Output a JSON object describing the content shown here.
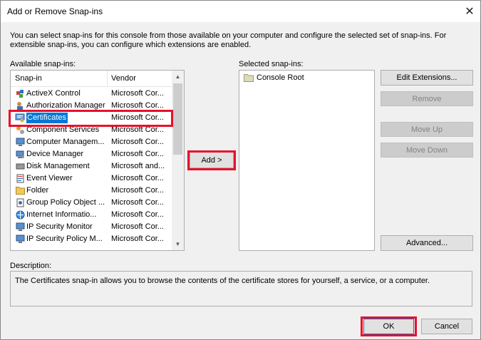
{
  "window": {
    "title": "Add or Remove Snap-ins",
    "close_glyph": "✕"
  },
  "intro_text": "You can select snap-ins for this console from those available on your computer and configure the selected set of snap-ins. For extensible snap-ins, you can configure which extensions are enabled.",
  "available": {
    "label": "Available snap-ins:",
    "columns": {
      "snapin": "Snap-in",
      "vendor": "Vendor"
    },
    "rows": [
      {
        "name": "ActiveX Control",
        "vendor": "Microsoft Cor...",
        "icon": "activex-icon"
      },
      {
        "name": "Authorization Manager",
        "vendor": "Microsoft Cor...",
        "icon": "authorization-manager-icon"
      },
      {
        "name": "Certificates",
        "vendor": "Microsoft Cor...",
        "icon": "certificates-icon",
        "selected": true
      },
      {
        "name": "Component Services",
        "vendor": "Microsoft Cor...",
        "icon": "component-services-icon"
      },
      {
        "name": "Computer Managem...",
        "vendor": "Microsoft Cor...",
        "icon": "computer-management-icon"
      },
      {
        "name": "Device Manager",
        "vendor": "Microsoft Cor...",
        "icon": "device-manager-icon"
      },
      {
        "name": "Disk Management",
        "vendor": "Microsoft and...",
        "icon": "disk-management-icon"
      },
      {
        "name": "Event Viewer",
        "vendor": "Microsoft Cor...",
        "icon": "event-viewer-icon"
      },
      {
        "name": "Folder",
        "vendor": "Microsoft Cor...",
        "icon": "folder-icon"
      },
      {
        "name": "Group Policy Object ...",
        "vendor": "Microsoft Cor...",
        "icon": "group-policy-icon"
      },
      {
        "name": "Internet Informatio...",
        "vendor": "Microsoft Cor...",
        "icon": "internet-information-icon"
      },
      {
        "name": "IP Security Monitor",
        "vendor": "Microsoft Cor...",
        "icon": "ip-security-monitor-icon"
      },
      {
        "name": "IP Security Policy M...",
        "vendor": "Microsoft Cor...",
        "icon": "ip-security-policy-icon"
      }
    ]
  },
  "add_button": "Add >",
  "selected": {
    "label": "Selected snap-ins:",
    "items": [
      {
        "name": "Console Root",
        "icon": "folder-icon"
      }
    ]
  },
  "side_buttons": {
    "edit_extensions": "Edit Extensions...",
    "remove": "Remove",
    "move_up": "Move Up",
    "move_down": "Move Down",
    "advanced": "Advanced..."
  },
  "description": {
    "label": "Description:",
    "text": "The Certificates snap-in allows you to browse the contents of the certificate stores for yourself, a service, or a computer."
  },
  "footer": {
    "ok": "OK",
    "cancel": "Cancel"
  },
  "colors": {
    "highlight": "#e8102a",
    "selection": "#0078d7",
    "dialog_bg": "#f0f0f0"
  }
}
